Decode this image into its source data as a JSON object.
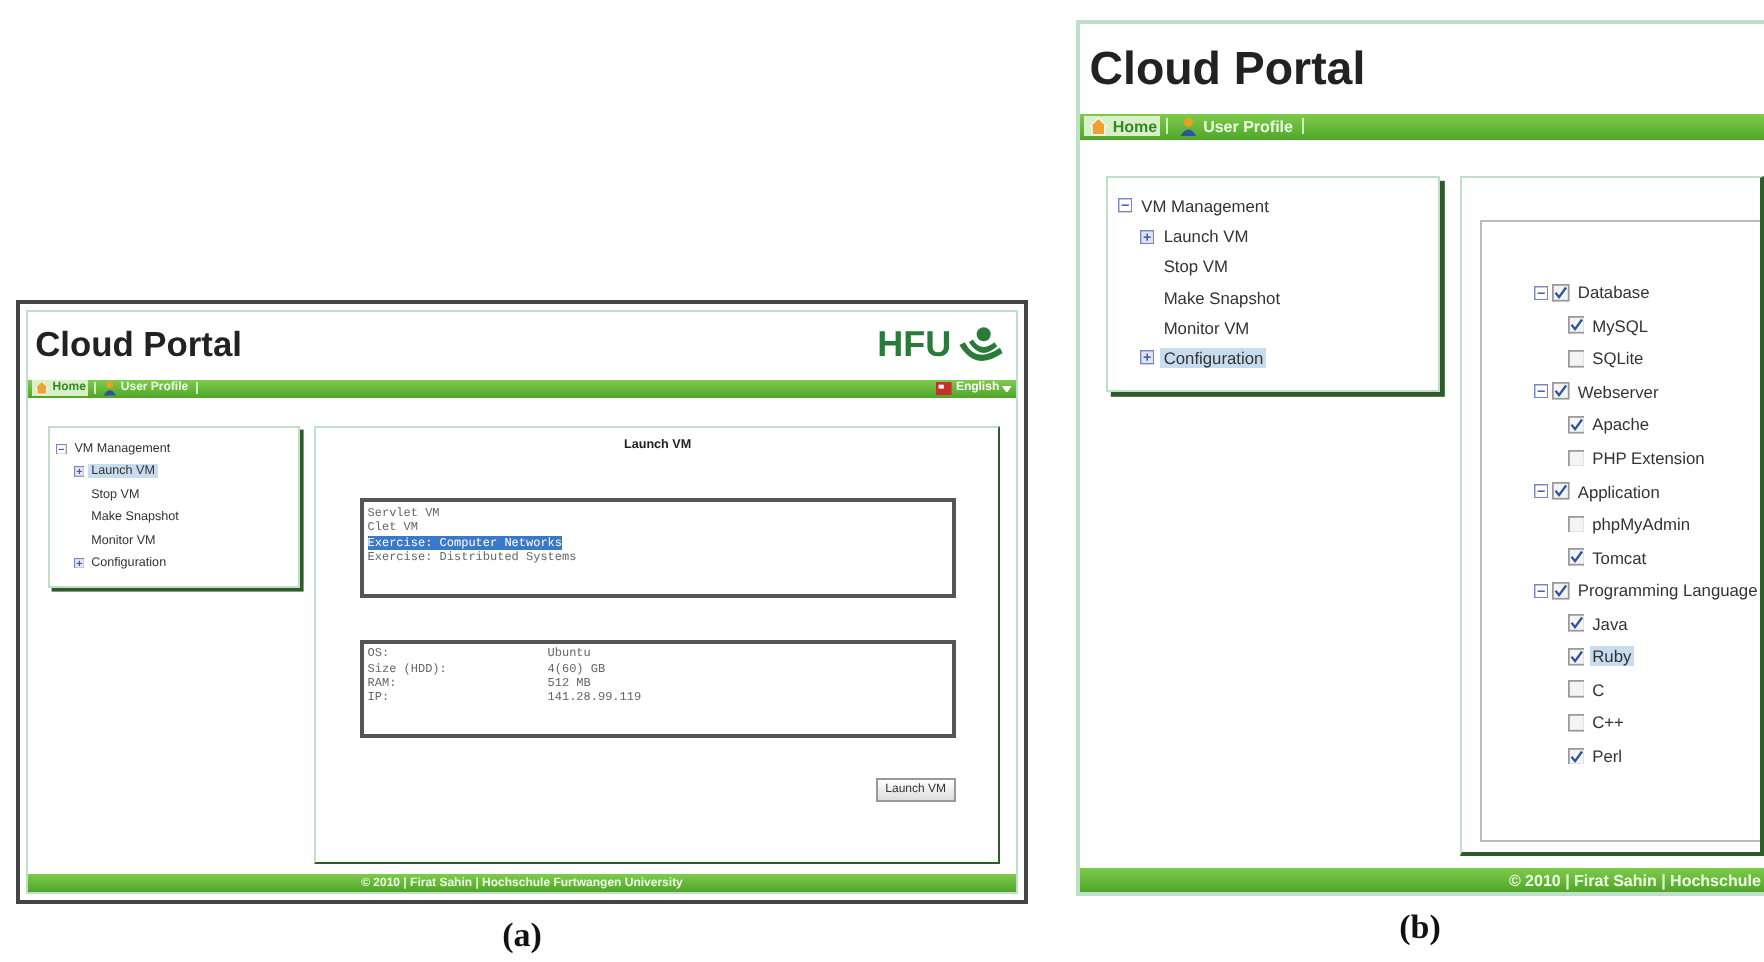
{
  "figures": [
    {
      "caption": "(a)",
      "title": "Cloud Portal",
      "logo_text": "HFU",
      "language": "English",
      "nav": [
        {
          "label": "Home",
          "kind": "home",
          "selected": true
        },
        {
          "label": "User Profile",
          "kind": "user",
          "selected": false
        }
      ],
      "menu": [
        {
          "label": "VM Management",
          "kind": "folder",
          "expanded": true,
          "selected": false,
          "children": [
            {
              "label": "Launch VM",
              "kind": "folder",
              "expanded": false,
              "selected": true
            },
            {
              "label": "Stop VM",
              "kind": "leaf",
              "selected": false
            },
            {
              "label": "Make Snapshot",
              "kind": "leaf",
              "selected": false
            },
            {
              "label": "Monitor VM",
              "kind": "leaf",
              "selected": false
            },
            {
              "label": "Configuration",
              "kind": "folder",
              "expanded": false,
              "selected": false
            }
          ]
        }
      ],
      "main": {
        "kind": "launch",
        "title": "Launch VM",
        "options": [
          {
            "text": "Servlet VM",
            "selected": false
          },
          {
            "text": "Clet VM",
            "selected": false
          },
          {
            "text": "Exercise: Computer Networks",
            "selected": true
          },
          {
            "text": "Exercise: Distributed Systems",
            "selected": false
          }
        ],
        "info": [
          {
            "label": "OS:",
            "value": "Ubuntu"
          },
          {
            "label": "Size (HDD):",
            "value": "4(60) GB"
          },
          {
            "label": "RAM:",
            "value": "512 MB"
          },
          {
            "label": "IP:",
            "value": "141.28.99.119"
          }
        ],
        "button": "Launch VM"
      },
      "footer": "© 2010 | Firat Sahin | Hochschule Furtwangen University"
    },
    {
      "caption": "(b)",
      "title": "Cloud Portal",
      "nav": [
        {
          "label": "Home",
          "kind": "home",
          "selected": true
        },
        {
          "label": "User Profile",
          "kind": "user",
          "selected": false
        }
      ],
      "menu": [
        {
          "label": "VM Management",
          "kind": "folder",
          "expanded": true,
          "selected": false,
          "children": [
            {
              "label": "Launch VM",
              "kind": "folder",
              "expanded": false,
              "selected": false
            },
            {
              "label": "Stop VM",
              "kind": "leaf",
              "selected": false
            },
            {
              "label": "Make Snapshot",
              "kind": "leaf",
              "selected": false
            },
            {
              "label": "Monitor VM",
              "kind": "leaf",
              "selected": false
            },
            {
              "label": "Configuration",
              "kind": "folder",
              "expanded": false,
              "selected": true
            }
          ]
        }
      ],
      "main": {
        "kind": "configuration",
        "tree": [
          {
            "label": "Database",
            "expanded": true,
            "checked": true,
            "selected": false,
            "children": [
              {
                "label": "MySQL",
                "checked": true,
                "selected": false
              },
              {
                "label": "SQLite",
                "checked": false,
                "selected": false
              }
            ]
          },
          {
            "label": "Webserver",
            "expanded": true,
            "checked": true,
            "selected": false,
            "children": [
              {
                "label": "Apache",
                "checked": true,
                "selected": false
              },
              {
                "label": "PHP Extension",
                "checked": false,
                "selected": false
              }
            ]
          },
          {
            "label": "Application",
            "expanded": true,
            "checked": true,
            "selected": false,
            "children": [
              {
                "label": "phpMyAdmin",
                "checked": false,
                "selected": false
              },
              {
                "label": "Tomcat",
                "checked": true,
                "selected": false
              }
            ]
          },
          {
            "label": "Programming Language",
            "expanded": true,
            "checked": true,
            "selected": false,
            "children": [
              {
                "label": "Java",
                "checked": true,
                "selected": false
              },
              {
                "label": "Ruby",
                "checked": true,
                "selected": true
              },
              {
                "label": "C",
                "checked": false,
                "selected": false
              },
              {
                "label": "C++",
                "checked": false,
                "selected": false
              },
              {
                "label": "Perl",
                "checked": true,
                "selected": false
              }
            ]
          }
        ]
      },
      "footer": "© 2010 | Firat Sahin | Hochschule"
    }
  ]
}
